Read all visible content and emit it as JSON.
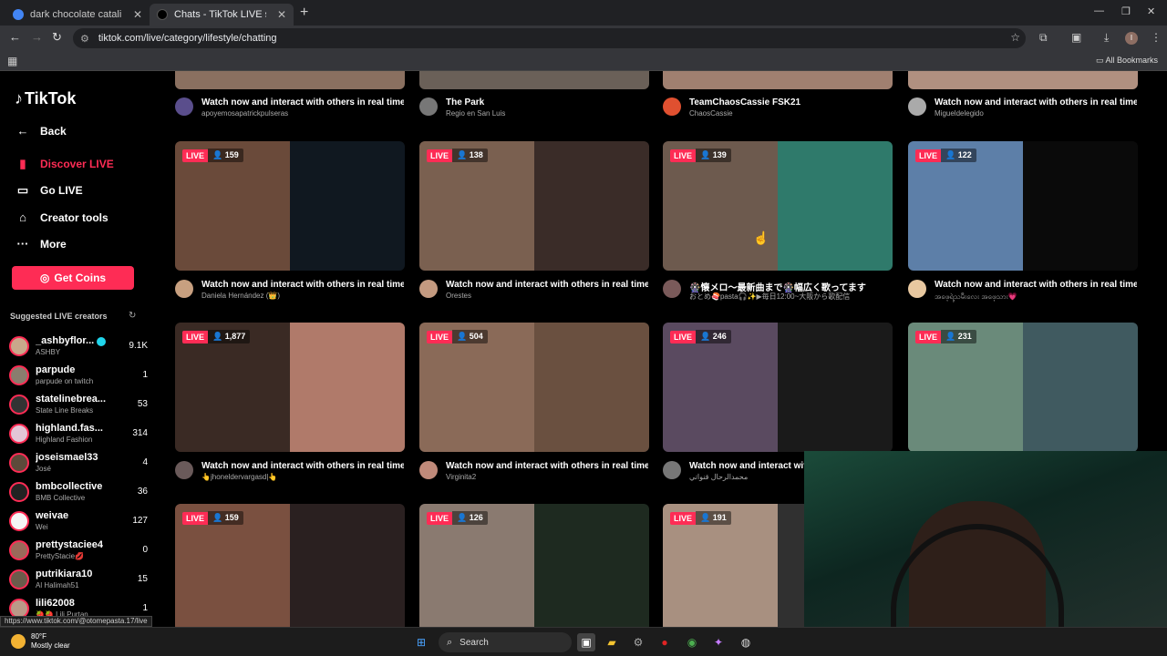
{
  "browser": {
    "tabs": [
      {
        "title": "dark chocolate catalina crunch",
        "favicon_color": "#4285f4"
      },
      {
        "title": "Chats - TikTok LIVE streams",
        "favicon_color": "#000000"
      }
    ],
    "url": "tiktok.com/live/category/lifestyle/chatting",
    "bookmarks_label": "All Bookmarks",
    "profile_initial": "I",
    "status_url": "https://www.tiktok.com/@otomepasta.17/live"
  },
  "sidebar": {
    "logo": "TikTok",
    "back": "Back",
    "nav": [
      {
        "label": "Discover LIVE",
        "icon": "tv-icon"
      },
      {
        "label": "Go LIVE",
        "icon": "camera-icon"
      },
      {
        "label": "Creator tools",
        "icon": "house-icon"
      },
      {
        "label": "More",
        "icon": "dots-icon"
      }
    ],
    "get_coins": "Get Coins",
    "suggested_heading": "Suggested LIVE creators",
    "creators": [
      {
        "name": "_ashbyflor...",
        "sub": "ASHBY",
        "viewers": "9.1K",
        "verified": true,
        "color": "#c9a88b"
      },
      {
        "name": "parpude",
        "sub": "parpude on twitch",
        "viewers": "1",
        "color": "#8a7d6e"
      },
      {
        "name": "statelinebrea...",
        "sub": "State Line Breaks",
        "viewers": "53",
        "color": "#333"
      },
      {
        "name": "highland.fas...",
        "sub": "Highland Fashion",
        "viewers": "314",
        "color": "#e3c6d6"
      },
      {
        "name": "joseismael33",
        "sub": "José",
        "viewers": "4",
        "color": "#5c4a3a"
      },
      {
        "name": "bmbcollective",
        "sub": "BMB Collective",
        "viewers": "36",
        "color": "#222"
      },
      {
        "name": "weivae",
        "sub": "Wei",
        "viewers": "127",
        "color": "#f5f5f5"
      },
      {
        "name": "prettystaciee4",
        "sub": "PrettyStacie💋",
        "viewers": "0",
        "color": "#9a6a5a"
      },
      {
        "name": "putrikiara10",
        "sub": "Al Halimah51",
        "viewers": "15",
        "color": "#6b5b4b"
      },
      {
        "name": "lili62008",
        "sub": "🍓🍓 Lili Purtan",
        "viewers": "1",
        "color": "#b98"
      }
    ]
  },
  "grid": {
    "top_captions": [
      {
        "title": "Watch now and interact with others in real time!",
        "user": "apoyemosapatrickpulseras",
        "color": "#5a4e8c"
      },
      {
        "title": "The Park",
        "user": "Regio en San Luis",
        "color": "#777"
      },
      {
        "title": "TeamChaosCassie FSK21",
        "user": "ChaosCassie",
        "color": "#e05030"
      },
      {
        "title": "Watch now and interact with others in real time!",
        "user": "Migueldelegido",
        "color": "#aaa"
      }
    ],
    "row1": [
      {
        "viewers": "159",
        "title": "Watch now and interact with others in real time!",
        "user": "Daniela Hernández (👑)",
        "colorA": "#6a4a3a",
        "colorB": "#101820",
        "avatar": "#c8a080"
      },
      {
        "viewers": "138",
        "title": "Watch now and interact with others in real time!",
        "user": "Orestes",
        "colorA": "#7a6050",
        "colorB": "#3a2c28",
        "avatar": "#c49a80"
      },
      {
        "viewers": "139",
        "title": "🎡懐メロ〜最新曲まで🎡幅広く歌ってます",
        "user": "おとめ🍣pasta🎧✨▶毎日12:00~大阪から歌配信",
        "colorA": "#6d5a4e",
        "colorB": "#2f7a6b",
        "avatar": "#7a5a5a"
      },
      {
        "viewers": "122",
        "title": "Watch now and interact with others in real time!",
        "user": "အဖေ့ရဲ့သမီးလေး အဖေ့သား💗",
        "colorA": "#5d7fa8",
        "colorB": "#0a0a0a",
        "avatar": "#e8c8a0"
      }
    ],
    "row2": [
      {
        "viewers": "1,877",
        "title": "Watch now and interact with others in real time!",
        "user": "👆jhoneldervargasd|👆",
        "colorA": "#3a2a24",
        "colorB": "#b07a6a",
        "avatar": "#6a5a5a"
      },
      {
        "viewers": "504",
        "title": "Watch now and interact with others in real time!",
        "user": "Virginita2",
        "colorA": "#8a6a58",
        "colorB": "#6a5040",
        "avatar": "#c08a7a"
      },
      {
        "viewers": "246",
        "title": "Watch now and interact with others in real time!",
        "user": "محمدالرحال قنواتي",
        "colorA": "#5a4a60",
        "colorB": "#1a1a1a",
        "avatar": "#777"
      },
      {
        "viewers": "231",
        "title": "",
        "user": "",
        "colorA": "#6a8a7a",
        "colorB": "#405a60",
        "avatar": "#444"
      }
    ],
    "row3": [
      {
        "viewers": "159",
        "colorA": "#7a5040",
        "colorB": "#2a2020"
      },
      {
        "viewers": "126",
        "colorA": "#8a7a70",
        "colorB": "#1e2a20"
      },
      {
        "viewers": "191",
        "colorA": "#a89080",
        "colorB": "#303030"
      }
    ],
    "live_label": "LIVE"
  },
  "taskbar": {
    "temp": "80°F",
    "condition": "Mostly clear",
    "search": "Search"
  }
}
